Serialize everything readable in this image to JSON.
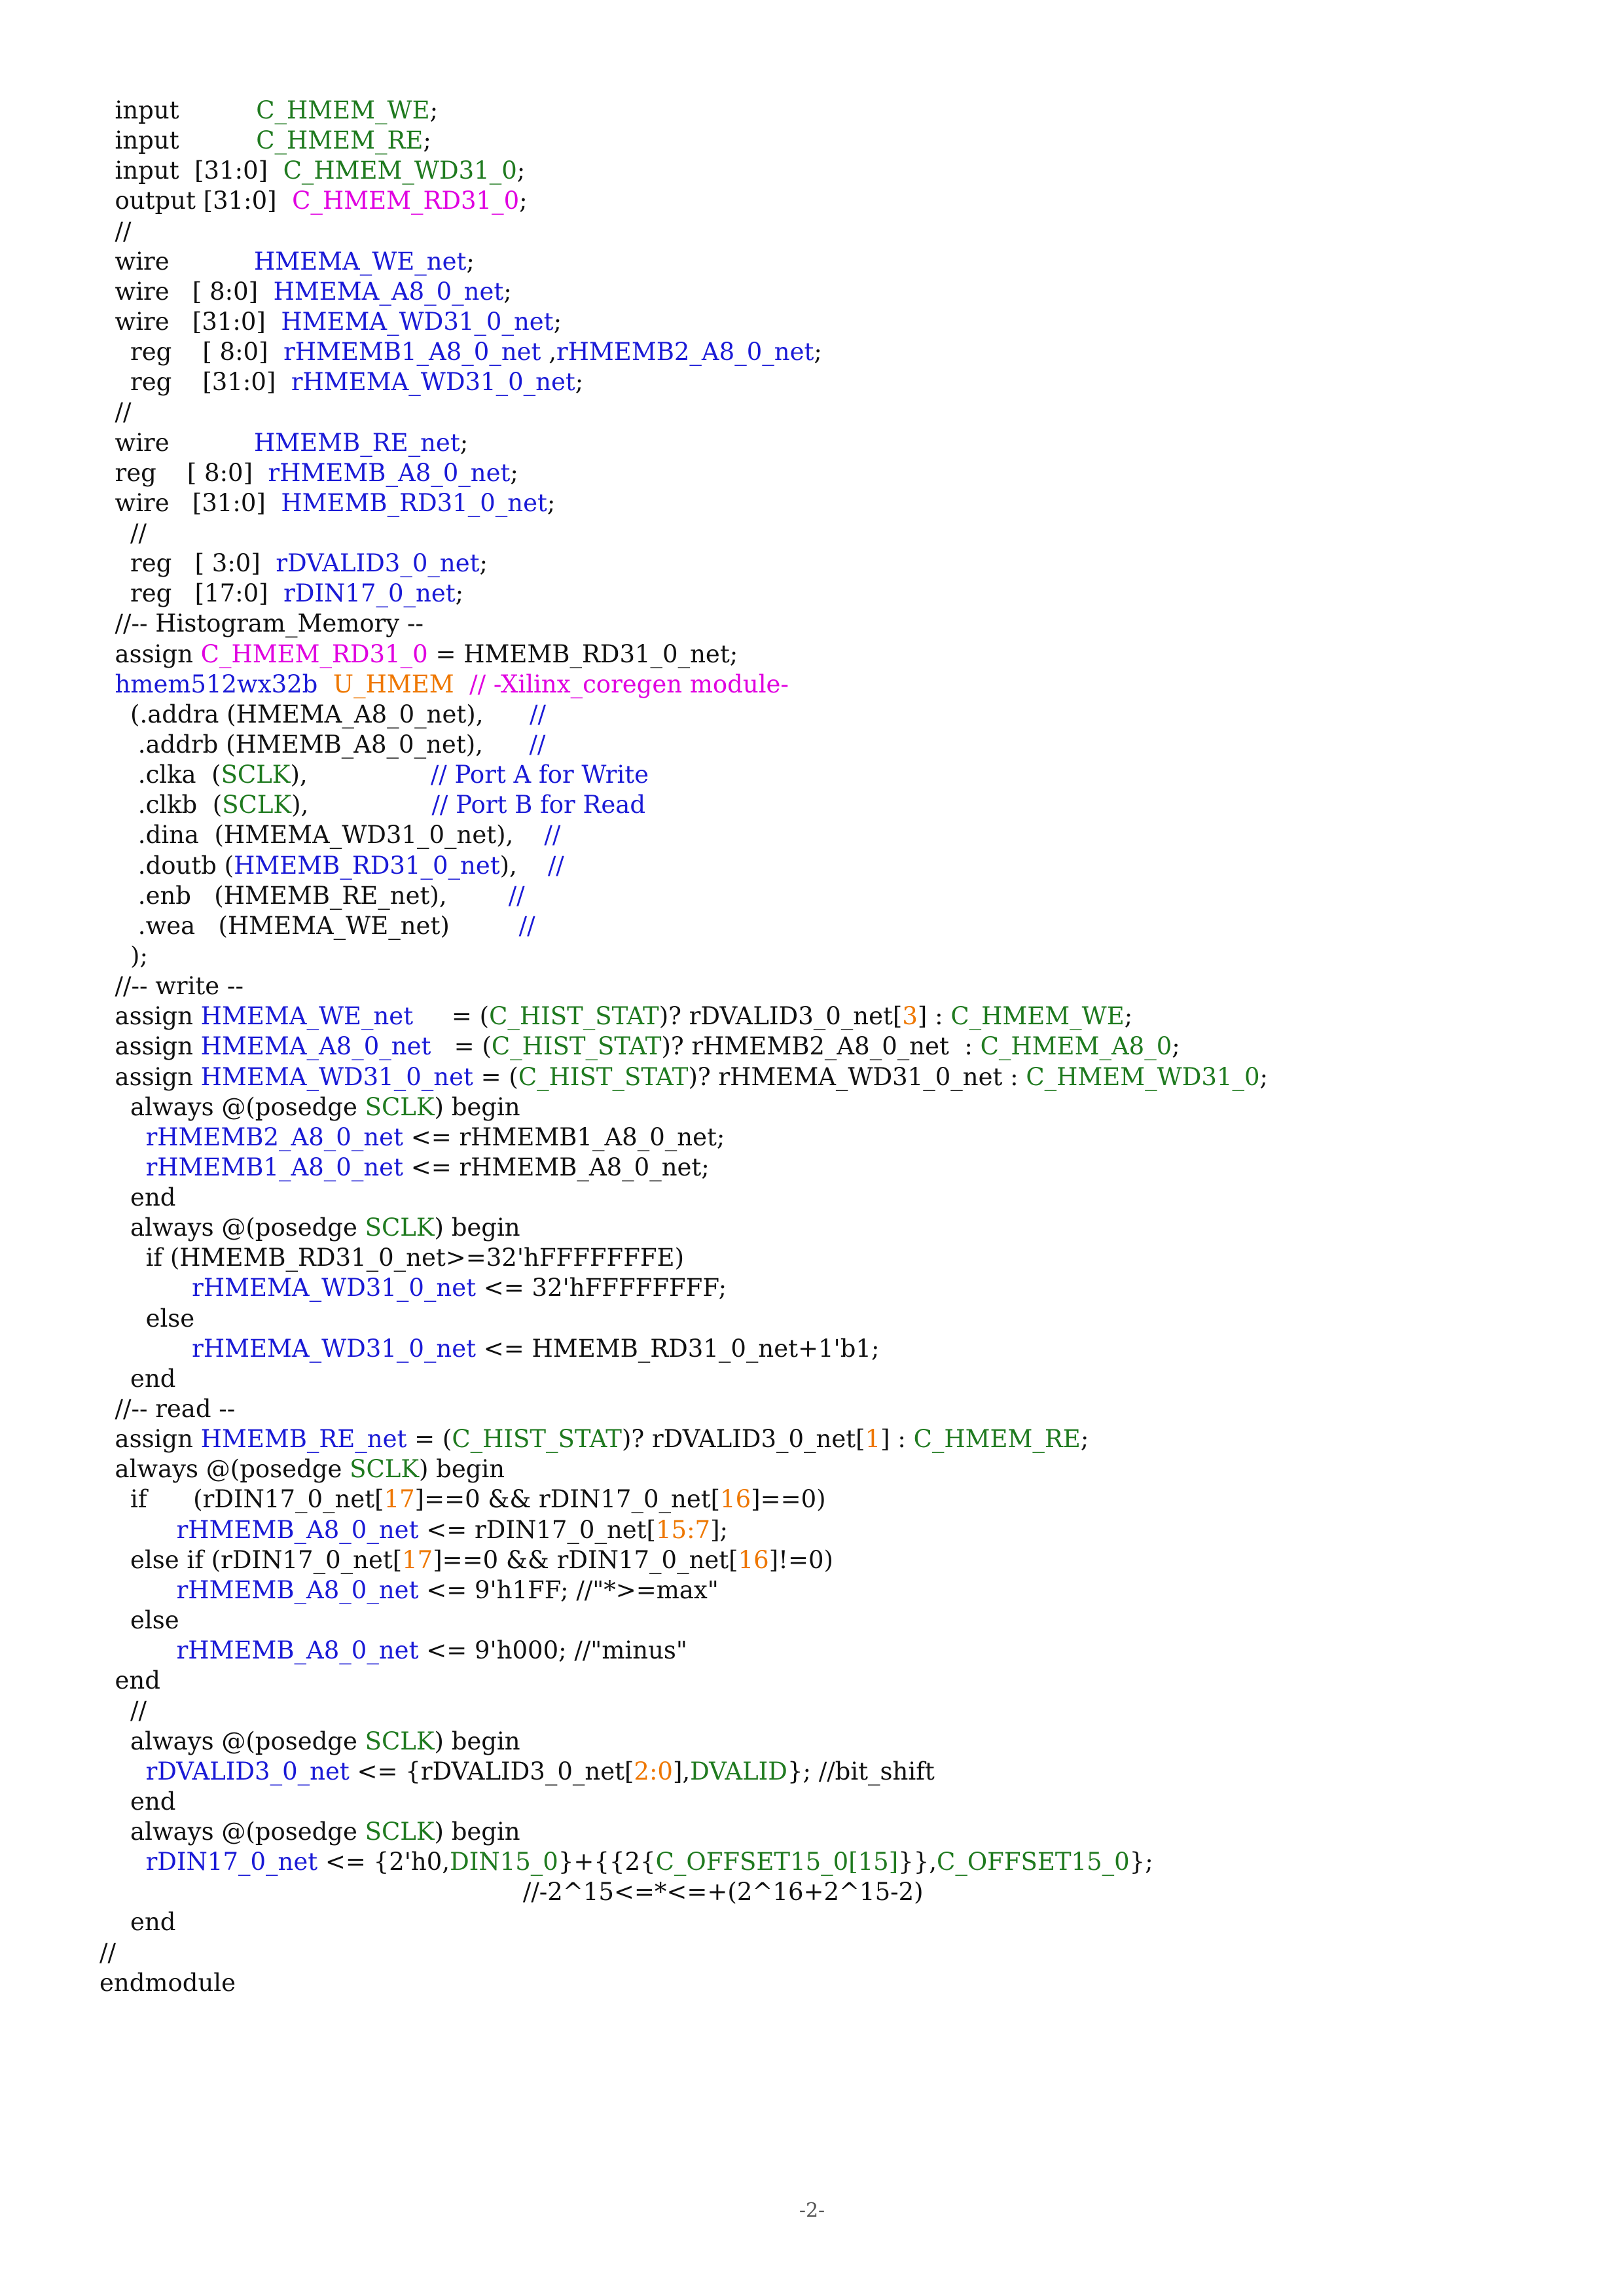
{
  "colors": {
    "text": "#111111",
    "signal_green": "#1f7a1f",
    "signal_blue": "#1a1ad6",
    "magenta": "#e000e0",
    "orange": "#ee7700"
  },
  "code_lines": [
    [
      {
        "t": "  input          ",
        "c": "k"
      },
      {
        "t": "C_HMEM_WE",
        "c": "g"
      },
      {
        "t": ";",
        "c": "k"
      }
    ],
    [
      {
        "t": "  input          ",
        "c": "k"
      },
      {
        "t": "C_HMEM_RE",
        "c": "g"
      },
      {
        "t": ";",
        "c": "k"
      }
    ],
    [
      {
        "t": "  input  [31:0]  ",
        "c": "k"
      },
      {
        "t": "C_HMEM_WD31_0",
        "c": "g"
      },
      {
        "t": ";",
        "c": "k"
      }
    ],
    [
      {
        "t": "  output [31:0]  ",
        "c": "k"
      },
      {
        "t": "C_HMEM_RD31_0",
        "c": "m"
      },
      {
        "t": ";",
        "c": "k"
      }
    ],
    [
      {
        "t": "  //",
        "c": "k"
      }
    ],
    [
      {
        "t": "  wire           ",
        "c": "k"
      },
      {
        "t": "HMEMA_WE_net",
        "c": "b"
      },
      {
        "t": ";",
        "c": "k"
      }
    ],
    [
      {
        "t": "  wire   [ 8:0]  ",
        "c": "k"
      },
      {
        "t": "HMEMA_A8_0_net",
        "c": "b"
      },
      {
        "t": ";",
        "c": "k"
      }
    ],
    [
      {
        "t": "  wire   [31:0]  ",
        "c": "k"
      },
      {
        "t": "HMEMA_WD31_0_net",
        "c": "b"
      },
      {
        "t": ";",
        "c": "k"
      }
    ],
    [
      {
        "t": "    reg    [ 8:0]  ",
        "c": "k"
      },
      {
        "t": "rHMEMB1_A8_0_net",
        "c": "b"
      },
      {
        "t": " ,",
        "c": "k"
      },
      {
        "t": "rHMEMB2_A8_0_net",
        "c": "b"
      },
      {
        "t": ";",
        "c": "k"
      }
    ],
    [
      {
        "t": "    reg    [31:0]  ",
        "c": "k"
      },
      {
        "t": "rHMEMA_WD31_0_net",
        "c": "b"
      },
      {
        "t": ";",
        "c": "k"
      }
    ],
    [
      {
        "t": "  //",
        "c": "k"
      }
    ],
    [
      {
        "t": "  wire           ",
        "c": "k"
      },
      {
        "t": "HMEMB_RE_net",
        "c": "b"
      },
      {
        "t": ";",
        "c": "k"
      }
    ],
    [
      {
        "t": "  reg    [ 8:0]  ",
        "c": "k"
      },
      {
        "t": "rHMEMB_A8_0_net",
        "c": "b"
      },
      {
        "t": ";",
        "c": "k"
      }
    ],
    [
      {
        "t": "  wire   [31:0]  ",
        "c": "k"
      },
      {
        "t": "HMEMB_RD31_0_net",
        "c": "b"
      },
      {
        "t": ";",
        "c": "k"
      }
    ],
    [
      {
        "t": "    //",
        "c": "k"
      }
    ],
    [
      {
        "t": "    reg   [ 3:0]  ",
        "c": "k"
      },
      {
        "t": "rDVALID3_0_net",
        "c": "b"
      },
      {
        "t": ";",
        "c": "k"
      }
    ],
    [
      {
        "t": "    reg   [17:0]  ",
        "c": "k"
      },
      {
        "t": "rDIN17_0_net",
        "c": "b"
      },
      {
        "t": ";",
        "c": "k"
      }
    ],
    [
      {
        "t": "  //-- Histogram_Memory --",
        "c": "k"
      }
    ],
    [
      {
        "t": "  assign ",
        "c": "k"
      },
      {
        "t": "C_HMEM_RD31_0",
        "c": "m"
      },
      {
        "t": " = HMEMB_RD31_0_net;",
        "c": "k"
      }
    ],
    [
      {
        "t": "  ",
        "c": "k"
      },
      {
        "t": "hmem512wx32b",
        "c": "b"
      },
      {
        "t": "  ",
        "c": "k"
      },
      {
        "t": "U_HMEM",
        "c": "o"
      },
      {
        "t": "  ",
        "c": "k"
      },
      {
        "t": "// -Xilinx_coregen module-",
        "c": "m"
      }
    ],
    [
      {
        "t": "    (.addra (HMEMA_A8_0_net),      ",
        "c": "k"
      },
      {
        "t": "//",
        "c": "b"
      }
    ],
    [
      {
        "t": "     .addrb (HMEMB_A8_0_net),      ",
        "c": "k"
      },
      {
        "t": "//",
        "c": "b"
      }
    ],
    [
      {
        "t": "     .clka  (",
        "c": "k"
      },
      {
        "t": "SCLK",
        "c": "g"
      },
      {
        "t": "),                ",
        "c": "k"
      },
      {
        "t": "// Port A for Write",
        "c": "b"
      }
    ],
    [
      {
        "t": "     .clkb  (",
        "c": "k"
      },
      {
        "t": "SCLK",
        "c": "g"
      },
      {
        "t": "),                ",
        "c": "k"
      },
      {
        "t": "// Port B for Read",
        "c": "b"
      }
    ],
    [
      {
        "t": "     .dina  (HMEMA_WD31_0_net),    ",
        "c": "k"
      },
      {
        "t": "//",
        "c": "b"
      }
    ],
    [
      {
        "t": "     .doutb (",
        "c": "k"
      },
      {
        "t": "HMEMB_RD31_0_net",
        "c": "b"
      },
      {
        "t": "),    ",
        "c": "k"
      },
      {
        "t": "//",
        "c": "b"
      }
    ],
    [
      {
        "t": "     .enb   (HMEMB_RE_net),        ",
        "c": "k"
      },
      {
        "t": "//",
        "c": "b"
      }
    ],
    [
      {
        "t": "     .wea   (HMEMA_WE_net)         ",
        "c": "k"
      },
      {
        "t": "//",
        "c": "b"
      }
    ],
    [
      {
        "t": "    );",
        "c": "k"
      }
    ],
    [
      {
        "t": "  //-- write --",
        "c": "k"
      }
    ],
    [
      {
        "t": "  assign ",
        "c": "k"
      },
      {
        "t": "HMEMA_WE_net",
        "c": "b"
      },
      {
        "t": "     = (",
        "c": "k"
      },
      {
        "t": "C_HIST_STAT",
        "c": "g"
      },
      {
        "t": ")? rDVALID3_0_net[",
        "c": "k"
      },
      {
        "t": "3",
        "c": "o"
      },
      {
        "t": "] : ",
        "c": "k"
      },
      {
        "t": "C_HMEM_WE",
        "c": "g"
      },
      {
        "t": ";",
        "c": "k"
      }
    ],
    [
      {
        "t": "  assign ",
        "c": "k"
      },
      {
        "t": "HMEMA_A8_0_net",
        "c": "b"
      },
      {
        "t": "   = (",
        "c": "k"
      },
      {
        "t": "C_HIST_STAT",
        "c": "g"
      },
      {
        "t": ")? rHMEMB2_A8_0_net  : ",
        "c": "k"
      },
      {
        "t": "C_HMEM_A8_0",
        "c": "g"
      },
      {
        "t": ";",
        "c": "k"
      }
    ],
    [
      {
        "t": "  assign ",
        "c": "k"
      },
      {
        "t": "HMEMA_WD31_0_net",
        "c": "b"
      },
      {
        "t": " = (",
        "c": "k"
      },
      {
        "t": "C_HIST_STAT",
        "c": "g"
      },
      {
        "t": ")? rHMEMA_WD31_0_net : ",
        "c": "k"
      },
      {
        "t": "C_HMEM_WD31_0",
        "c": "g"
      },
      {
        "t": ";",
        "c": "k"
      }
    ],
    [
      {
        "t": "    always @(posedge ",
        "c": "k"
      },
      {
        "t": "SCLK",
        "c": "g"
      },
      {
        "t": ") begin",
        "c": "k"
      }
    ],
    [
      {
        "t": "      ",
        "c": "k"
      },
      {
        "t": "rHMEMB2_A8_0_net",
        "c": "b"
      },
      {
        "t": " <= rHMEMB1_A8_0_net;",
        "c": "k"
      }
    ],
    [
      {
        "t": "      ",
        "c": "k"
      },
      {
        "t": "rHMEMB1_A8_0_net",
        "c": "b"
      },
      {
        "t": " <= rHMEMB_A8_0_net;",
        "c": "k"
      }
    ],
    [
      {
        "t": "    end",
        "c": "k"
      }
    ],
    [
      {
        "t": "    always @(posedge ",
        "c": "k"
      },
      {
        "t": "SCLK",
        "c": "g"
      },
      {
        "t": ") begin",
        "c": "k"
      }
    ],
    [
      {
        "t": "      if (HMEMB_RD31_0_net>=32'hFFFFFFFE)",
        "c": "k"
      }
    ],
    [
      {
        "t": "            ",
        "c": "k"
      },
      {
        "t": "rHMEMA_WD31_0_net",
        "c": "b"
      },
      {
        "t": " <= 32'hFFFFFFFF;",
        "c": "k"
      }
    ],
    [
      {
        "t": "      else",
        "c": "k"
      }
    ],
    [
      {
        "t": "            ",
        "c": "k"
      },
      {
        "t": "rHMEMA_WD31_0_net",
        "c": "b"
      },
      {
        "t": " <= HMEMB_RD31_0_net+1'b1;",
        "c": "k"
      }
    ],
    [
      {
        "t": "    end",
        "c": "k"
      }
    ],
    [
      {
        "t": "  //-- read --",
        "c": "k"
      }
    ],
    [
      {
        "t": "  assign ",
        "c": "k"
      },
      {
        "t": "HMEMB_RE_net",
        "c": "b"
      },
      {
        "t": " = (",
        "c": "k"
      },
      {
        "t": "C_HIST_STAT",
        "c": "g"
      },
      {
        "t": ")? rDVALID3_0_net[",
        "c": "k"
      },
      {
        "t": "1",
        "c": "o"
      },
      {
        "t": "] : ",
        "c": "k"
      },
      {
        "t": "C_HMEM_RE",
        "c": "g"
      },
      {
        "t": ";",
        "c": "k"
      }
    ],
    [
      {
        "t": "  always @(posedge ",
        "c": "k"
      },
      {
        "t": "SCLK",
        "c": "g"
      },
      {
        "t": ") begin",
        "c": "k"
      }
    ],
    [
      {
        "t": "    if      (rDIN17_0_net[",
        "c": "k"
      },
      {
        "t": "17",
        "c": "o"
      },
      {
        "t": "]==0 && rDIN17_0_net[",
        "c": "k"
      },
      {
        "t": "16",
        "c": "o"
      },
      {
        "t": "]==0)",
        "c": "k"
      }
    ],
    [
      {
        "t": "          ",
        "c": "k"
      },
      {
        "t": "rHMEMB_A8_0_net",
        "c": "b"
      },
      {
        "t": " <= rDIN17_0_net[",
        "c": "k"
      },
      {
        "t": "15:7",
        "c": "o"
      },
      {
        "t": "];",
        "c": "k"
      }
    ],
    [
      {
        "t": "    else if (rDIN17_0_net[",
        "c": "k"
      },
      {
        "t": "17",
        "c": "o"
      },
      {
        "t": "]==0 && rDIN17_0_net[",
        "c": "k"
      },
      {
        "t": "16",
        "c": "o"
      },
      {
        "t": "]!=0)",
        "c": "k"
      }
    ],
    [
      {
        "t": "          ",
        "c": "k"
      },
      {
        "t": "rHMEMB_A8_0_net",
        "c": "b"
      },
      {
        "t": " <= 9'h1FF; //\"*>=max\"",
        "c": "k"
      }
    ],
    [
      {
        "t": "    else",
        "c": "k"
      }
    ],
    [
      {
        "t": "          ",
        "c": "k"
      },
      {
        "t": "rHMEMB_A8_0_net",
        "c": "b"
      },
      {
        "t": " <= 9'h000; //\"minus\"",
        "c": "k"
      }
    ],
    [
      {
        "t": "  end",
        "c": "k"
      }
    ],
    [
      {
        "t": "    //",
        "c": "k"
      }
    ],
    [
      {
        "t": "    always @(posedge ",
        "c": "k"
      },
      {
        "t": "SCLK",
        "c": "g"
      },
      {
        "t": ") begin",
        "c": "k"
      }
    ],
    [
      {
        "t": "      ",
        "c": "k"
      },
      {
        "t": "rDVALID3_0_net",
        "c": "b"
      },
      {
        "t": " <= {rDVALID3_0_net[",
        "c": "k"
      },
      {
        "t": "2:0",
        "c": "o"
      },
      {
        "t": "],",
        "c": "k"
      },
      {
        "t": "DVALID",
        "c": "g"
      },
      {
        "t": "}; //bit_shift",
        "c": "k"
      }
    ],
    [
      {
        "t": "    end",
        "c": "k"
      }
    ],
    [
      {
        "t": "    always @(posedge ",
        "c": "k"
      },
      {
        "t": "SCLK",
        "c": "g"
      },
      {
        "t": ") begin",
        "c": "k"
      }
    ],
    [
      {
        "t": "      ",
        "c": "k"
      },
      {
        "t": "rDIN17_0_net",
        "c": "b"
      },
      {
        "t": " <= {2'h0,",
        "c": "k"
      },
      {
        "t": "DIN15_0",
        "c": "g"
      },
      {
        "t": "}+{{2{",
        "c": "k"
      },
      {
        "t": "C_OFFSET15_0[15]",
        "c": "g"
      },
      {
        "t": "}},",
        "c": "k"
      },
      {
        "t": "C_OFFSET15_0",
        "c": "g"
      },
      {
        "t": "};",
        "c": "k"
      }
    ],
    [
      {
        "t": "                                                       //-2^15<=*<=+(2^16+2^15-2)",
        "c": "k"
      }
    ],
    [
      {
        "t": "    end",
        "c": "k"
      }
    ],
    [
      {
        "t": "//",
        "c": "k"
      }
    ],
    [
      {
        "t": "endmodule",
        "c": "k"
      }
    ]
  ],
  "footer": {
    "page_number": "-2-"
  }
}
